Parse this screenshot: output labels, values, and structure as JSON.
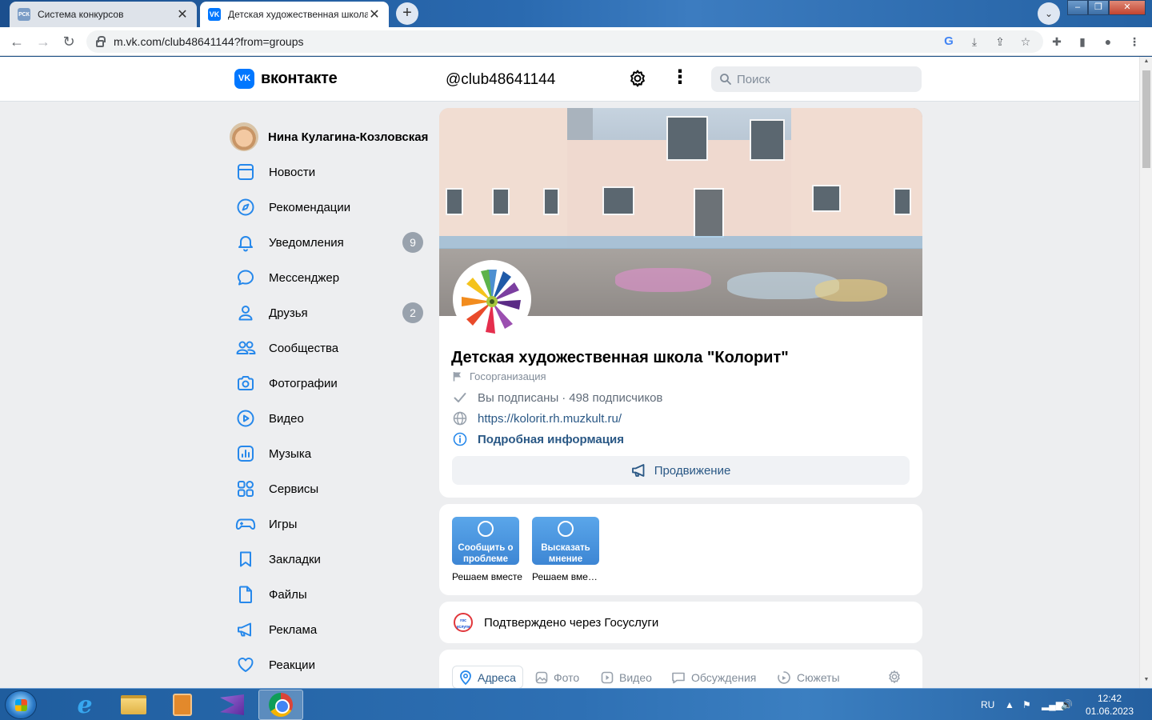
{
  "browser": {
    "tabs": [
      {
        "title": "Система конкурсов",
        "favicon": "rsk-favicon"
      },
      {
        "title": "Детская художественная школа",
        "favicon": "vk-favicon"
      }
    ],
    "url": "m.vk.com/club48641144?from=groups"
  },
  "vk": {
    "logo_text": "вконтакте",
    "club_handle": "@club48641144",
    "search_placeholder": "Поиск",
    "accent": "#0077ff"
  },
  "menu": {
    "profile_name": "Нина Кулагина-Козловская",
    "items": [
      {
        "label": "Новости",
        "icon": "news-icon"
      },
      {
        "label": "Рекомендации",
        "icon": "compass-icon"
      },
      {
        "label": "Уведомления",
        "icon": "bell-icon",
        "badge": "9"
      },
      {
        "label": "Мессенджер",
        "icon": "chat-icon"
      },
      {
        "label": "Друзья",
        "icon": "user-icon",
        "badge": "2"
      },
      {
        "label": "Сообщества",
        "icon": "users-icon"
      },
      {
        "label": "Фотографии",
        "icon": "camera-icon"
      },
      {
        "label": "Видео",
        "icon": "play-icon"
      },
      {
        "label": "Музыка",
        "icon": "music-icon"
      },
      {
        "label": "Сервисы",
        "icon": "services-icon"
      },
      {
        "label": "Игры",
        "icon": "gamepad-icon"
      },
      {
        "label": "Закладки",
        "icon": "bookmark-icon"
      },
      {
        "label": "Файлы",
        "icon": "file-icon"
      },
      {
        "label": "Реклама",
        "icon": "megaphone-icon"
      },
      {
        "label": "Реакции",
        "icon": "heart-icon"
      }
    ]
  },
  "group": {
    "name": "Детская художественная школа \"Колорит\"",
    "type": "Госорганизация",
    "subscribed": "Вы подписаны",
    "separator": "·",
    "subscribers": "498 подписчиков",
    "website": "https://kolorit.rh.muzkult.ru/",
    "details": "Подробная информация",
    "promote": "Продвижение"
  },
  "widgets": [
    {
      "tile": "Сообщить о проблеме",
      "caption": "Решаем вместе"
    },
    {
      "tile": "Высказать мнение",
      "caption": "Решаем вместе"
    }
  ],
  "verified": {
    "logo": "гос услуги",
    "text": "Подтверждено через Госуслуги"
  },
  "group_tabs": [
    {
      "label": "Адреса",
      "icon": "pin-icon"
    },
    {
      "label": "Фото",
      "icon": "photo-icon"
    },
    {
      "label": "Видео",
      "icon": "video-icon"
    },
    {
      "label": "Обсуждения",
      "icon": "discussion-icon"
    },
    {
      "label": "Сюжеты",
      "icon": "stories-icon"
    }
  ],
  "taskbar": {
    "lang": "RU",
    "time": "12:42",
    "date": "01.06.2023"
  }
}
